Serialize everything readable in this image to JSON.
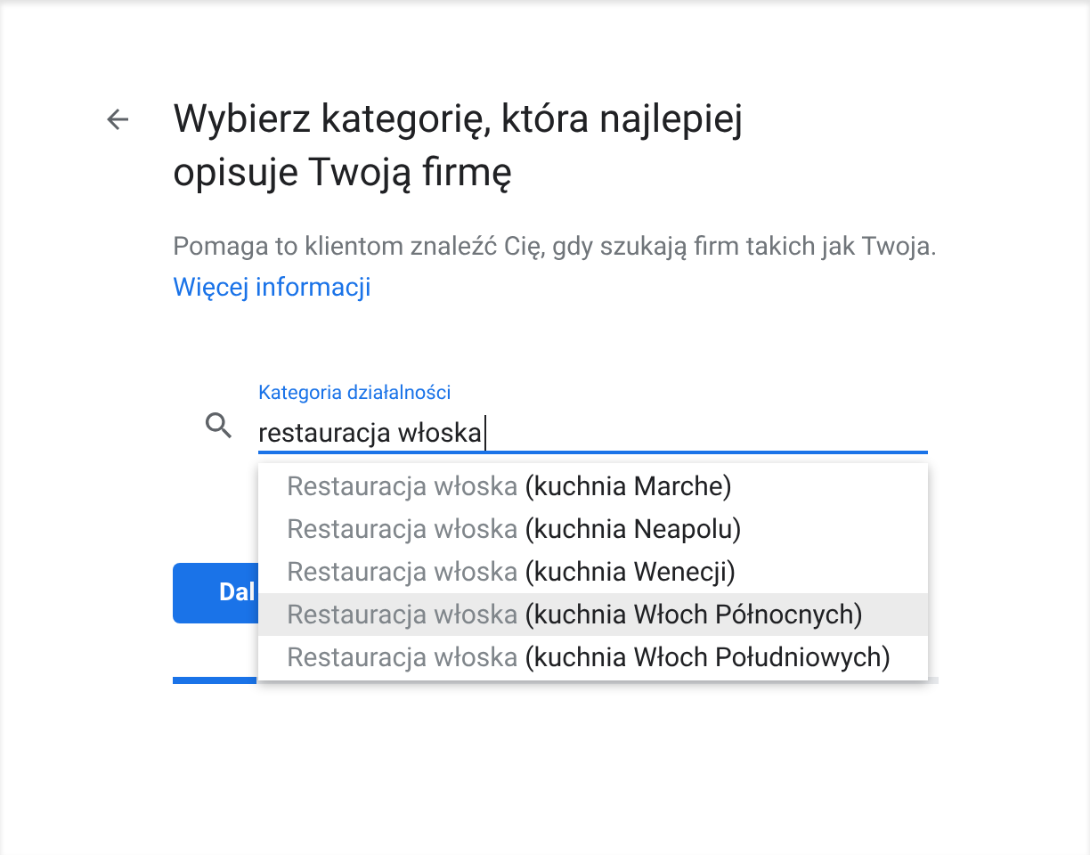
{
  "header": {
    "title": "Wybierz kategorię, która najlepiej opisuje Twoją firmę",
    "description": "Pomaga to klientom znaleźć Cię, gdy szukają firm takich jak Twoja.",
    "link": "Więcej informacji"
  },
  "field": {
    "label": "Kategoria działalności",
    "value": "restauracja włoska"
  },
  "suggestions": [
    {
      "match": "Restauracja włoska",
      "rest": "(kuchnia Marche)",
      "selected": false
    },
    {
      "match": "Restauracja włoska",
      "rest": "(kuchnia Neapolu)",
      "selected": false
    },
    {
      "match": "Restauracja włoska",
      "rest": "(kuchnia Wenecji)",
      "selected": false
    },
    {
      "match": "Restauracja włoska",
      "rest": "(kuchnia Włoch Północnych)",
      "selected": true
    },
    {
      "match": "Restauracja włoska",
      "rest": "(kuchnia Włoch Południowych)",
      "selected": false
    }
  ],
  "next_button": {
    "label": "Dal"
  },
  "progress": {
    "level": 0.11
  }
}
